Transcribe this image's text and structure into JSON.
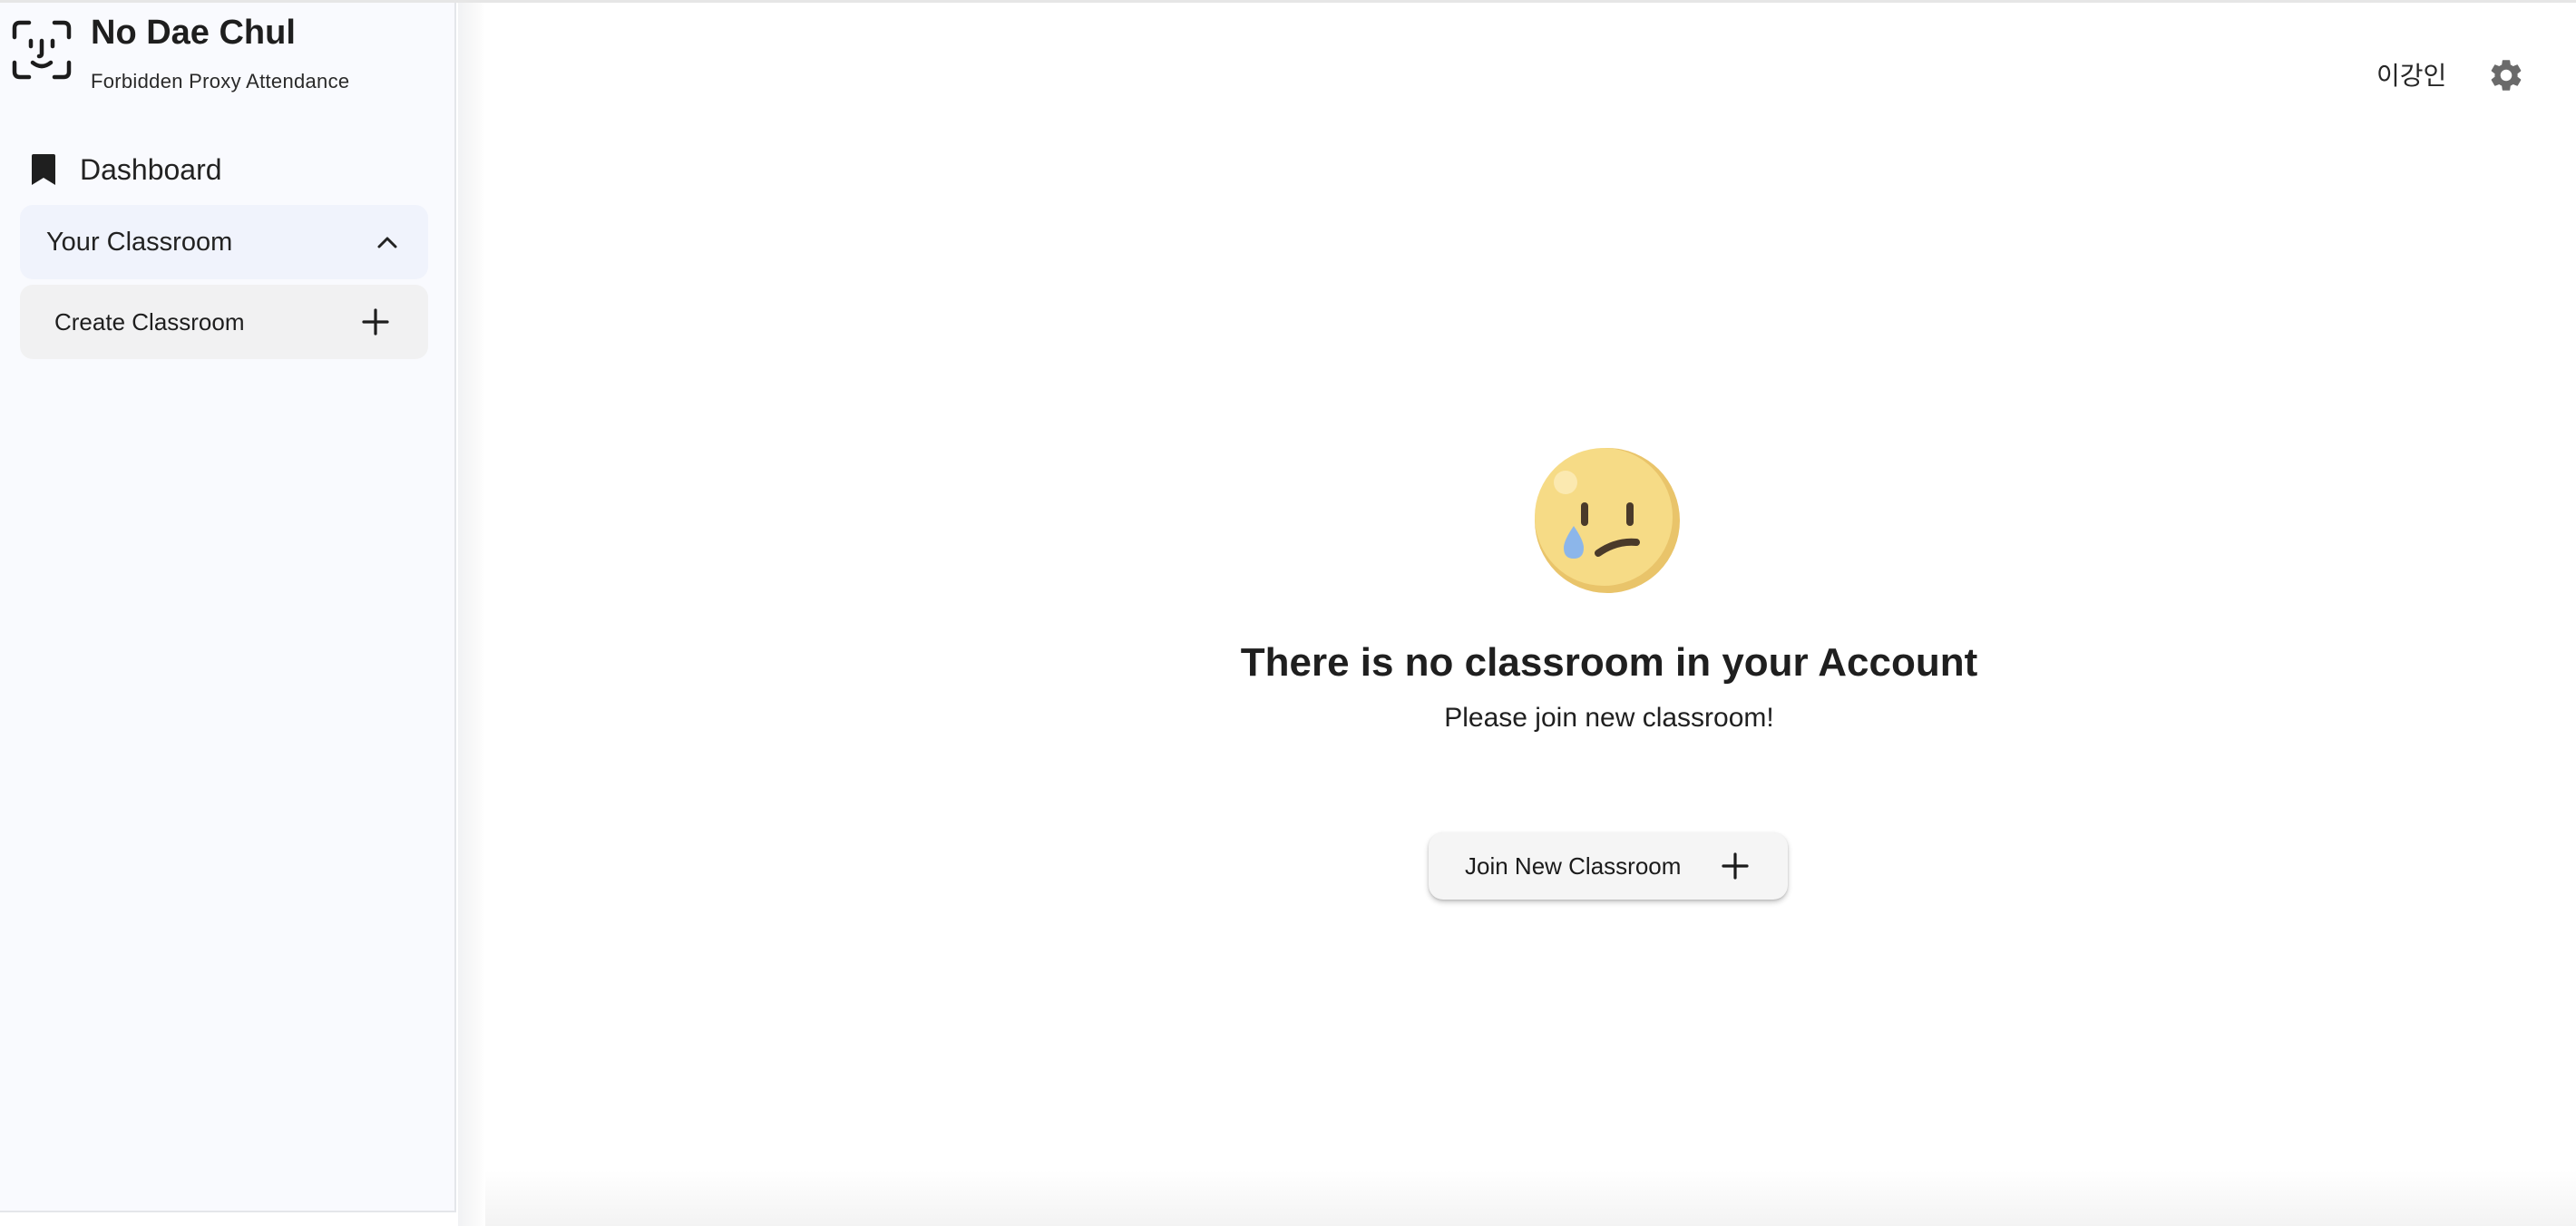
{
  "brand": {
    "title": "No Dae Chul",
    "subtitle": "Forbidden Proxy Attendance",
    "icon": "face-id-icon"
  },
  "sidebar": {
    "dashboard_label": "Dashboard",
    "dashboard_icon": "bookmark-icon",
    "your_classroom_label": "Your Classroom",
    "your_classroom_icon": "chevron-up-icon",
    "create_classroom_label": "Create Classroom",
    "create_classroom_icon": "plus-icon"
  },
  "header": {
    "user_name": "이강인",
    "settings_icon": "gear-icon"
  },
  "empty_state": {
    "icon": "crying-face-emoji",
    "title": "There is no classroom in your Account",
    "subtitle": "Please join new classroom!",
    "join_button_label": "Join New Classroom",
    "join_button_icon": "plus-icon"
  },
  "colors": {
    "sidebar_bg": "#f9fafe",
    "selected_item_bg": "#f0f3fc",
    "button_bg": "#f5f5f5",
    "text": "#1f1f1f",
    "emoji_face": "#f6db86",
    "emoji_tear": "#8cb6ea"
  }
}
